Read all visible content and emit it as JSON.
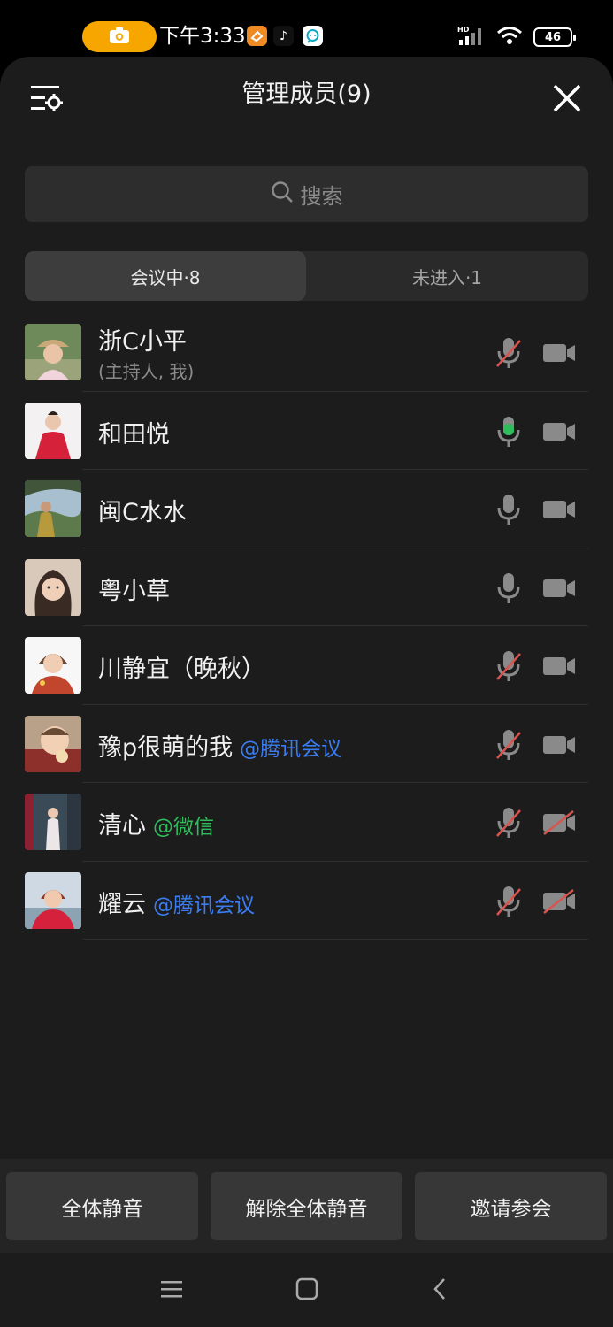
{
  "status_bar": {
    "time": "下午3:33",
    "battery": "46",
    "network": "HD"
  },
  "header": {
    "title": "管理成员(9)"
  },
  "search": {
    "placeholder": "搜索"
  },
  "tabs": [
    {
      "label": "会议中·8",
      "active": true
    },
    {
      "label": "未进入·1",
      "active": false
    }
  ],
  "members": [
    {
      "name": "浙C小平",
      "sub": "(主持人, 我)",
      "tag": "",
      "mic": "muted",
      "camera": "off"
    },
    {
      "name": "和田悦",
      "tag": "",
      "mic": "speaking",
      "camera": "off"
    },
    {
      "name": "闽C水水",
      "tag": "",
      "mic": "on",
      "camera": "off"
    },
    {
      "name": "粤小草",
      "tag": "",
      "mic": "on",
      "camera": "off"
    },
    {
      "name": "川静宜（晚秋）",
      "tag": "",
      "mic": "muted",
      "camera": "off"
    },
    {
      "name": "豫p很萌的我",
      "tag": "@腾讯会议",
      "tag_color": "blue",
      "mic": "muted",
      "camera": "off"
    },
    {
      "name": "清心",
      "tag": "@微信",
      "tag_color": "green",
      "mic": "muted",
      "camera": "disabled"
    },
    {
      "name": "耀云",
      "tag": "@腾讯会议",
      "tag_color": "blue",
      "mic": "muted",
      "camera": "disabled"
    }
  ],
  "actions": {
    "mute_all": "全体静音",
    "unmute_all": "解除全体静音",
    "invite": "邀请参会"
  },
  "colors": {
    "background": "#1c1c1c",
    "accent_blue": "#3b7df0",
    "accent_green": "#2fbd5c",
    "mute_red": "#d9534f",
    "camera_pill": "#f7a600"
  }
}
